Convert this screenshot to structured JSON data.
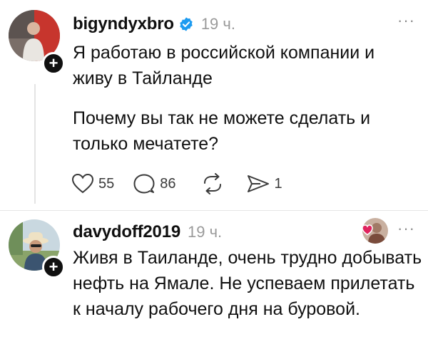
{
  "posts": [
    {
      "username": "bigyndyxbro",
      "verified": true,
      "time": "19 ч.",
      "more": "···",
      "paragraphs": [
        "Я работаю в российской компании и живу в Тайланде",
        "Почему вы так не можете сделать и только мечатете?"
      ],
      "actions": {
        "likes": "55",
        "comments": "86",
        "shares": "1"
      },
      "icons": [
        "heart-icon",
        "comment-icon",
        "repost-icon",
        "send-icon"
      ]
    },
    {
      "username": "davydoff2019",
      "time": "19 ч.",
      "more": "···",
      "paragraphs": [
        "Живя в Таиланде, очень трудно добывать нефть на Ямале. Не успеваем прилетать к началу рабочего дня на буровой."
      ]
    }
  ],
  "colors": {
    "verified": "#1d9bf0",
    "muted": "#9a9a9a",
    "heart_reaction": "#e0245e"
  }
}
